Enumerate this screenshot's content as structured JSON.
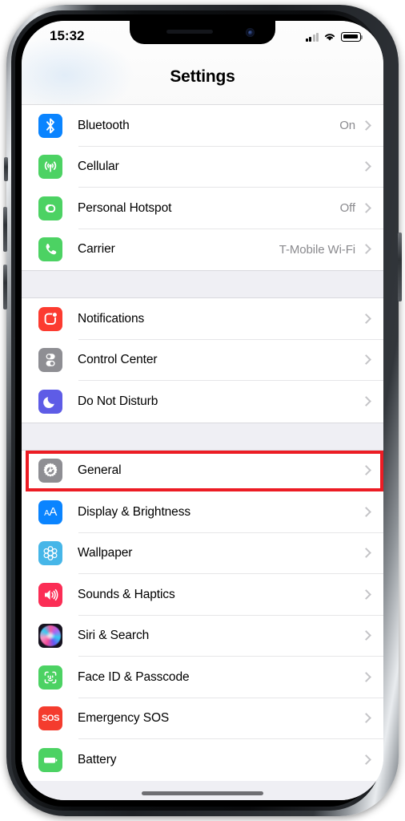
{
  "device": {
    "name": "iphone-x",
    "frame_color": "#1d2024"
  },
  "status_bar": {
    "time": "15:32",
    "signal_label": "signal-bars",
    "signal_bars_filled": 2,
    "signal_bars_total": 4,
    "wifi_label": "wifi",
    "battery_label": "battery",
    "battery_level_percent": 85
  },
  "header": {
    "title": "Settings"
  },
  "highlight": {
    "target_row": "General",
    "color": "#ec1c24"
  },
  "groups": [
    {
      "id": "connectivity",
      "rows": [
        {
          "label": "Bluetooth",
          "value": "On",
          "icon": "bluetooth-icon",
          "icon_color": "#0a84ff"
        },
        {
          "label": "Cellular",
          "value": "",
          "icon": "cellular-icon",
          "icon_color": "#4cd263"
        },
        {
          "label": "Personal Hotspot",
          "value": "Off",
          "icon": "hotspot-icon",
          "icon_color": "#4cd263"
        },
        {
          "label": "Carrier",
          "value": "T-Mobile Wi-Fi",
          "icon": "phone-icon",
          "icon_color": "#4cd263"
        }
      ]
    },
    {
      "id": "alerts",
      "rows": [
        {
          "label": "Notifications",
          "value": "",
          "icon": "notifications-icon",
          "icon_color": "#fc3b30"
        },
        {
          "label": "Control Center",
          "value": "",
          "icon": "control-center-icon",
          "icon_color": "#8e8e93"
        },
        {
          "label": "Do Not Disturb",
          "value": "",
          "icon": "moon-icon",
          "icon_color": "#5e5ce6"
        }
      ]
    },
    {
      "id": "system",
      "rows": [
        {
          "label": "General",
          "value": "",
          "icon": "gear-icon",
          "icon_color": "#8e8e93"
        },
        {
          "label": "Display & Brightness",
          "value": "",
          "icon": "text-size-icon",
          "icon_color": "#0a84ff"
        },
        {
          "label": "Wallpaper",
          "value": "",
          "icon": "wallpaper-icon",
          "icon_color": "#46b6e8"
        },
        {
          "label": "Sounds & Haptics",
          "value": "",
          "icon": "speaker-icon",
          "icon_color": "#fb2d55"
        },
        {
          "label": "Siri & Search",
          "value": "",
          "icon": "siri-icon",
          "icon_color": "#16121f"
        },
        {
          "label": "Face ID & Passcode",
          "value": "",
          "icon": "face-id-icon",
          "icon_color": "#4cd263"
        },
        {
          "label": "Emergency SOS",
          "value": "",
          "icon": "sos-icon",
          "icon_color": "#f43c2e"
        },
        {
          "label": "Battery",
          "value": "",
          "icon": "battery-icon",
          "icon_color": "#4cd263"
        }
      ]
    }
  ]
}
